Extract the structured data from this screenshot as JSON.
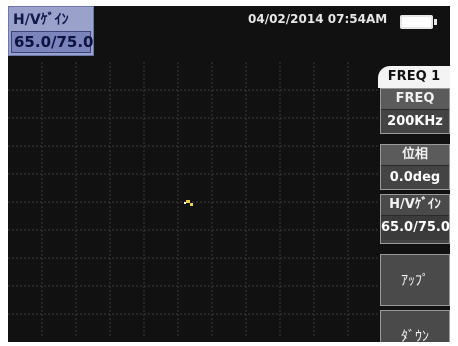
{
  "gain_indicator": {
    "label": "H/Vｹﾞｲﾝ",
    "value": "65.0/75.0"
  },
  "status_bar": {
    "datetime": "04/02/2014  07:54AM",
    "battery_icon": "battery-icon"
  },
  "menu": {
    "title": "FREQ 1",
    "params": [
      {
        "label": "FREQ",
        "value": "200KHz"
      },
      {
        "label": "位相",
        "value": "0.0deg"
      },
      {
        "label": "H/Vｹﾞｲﾝ",
        "value": "65.0/75.0"
      }
    ],
    "actions": [
      {
        "label": "ｱｯﾌﾟ"
      },
      {
        "label": "ﾀﾞｳﾝ"
      }
    ]
  },
  "colors": {
    "screen_bg": "#111111",
    "grid_line": "#3a3a3a",
    "cursor": "#e8d24a"
  }
}
